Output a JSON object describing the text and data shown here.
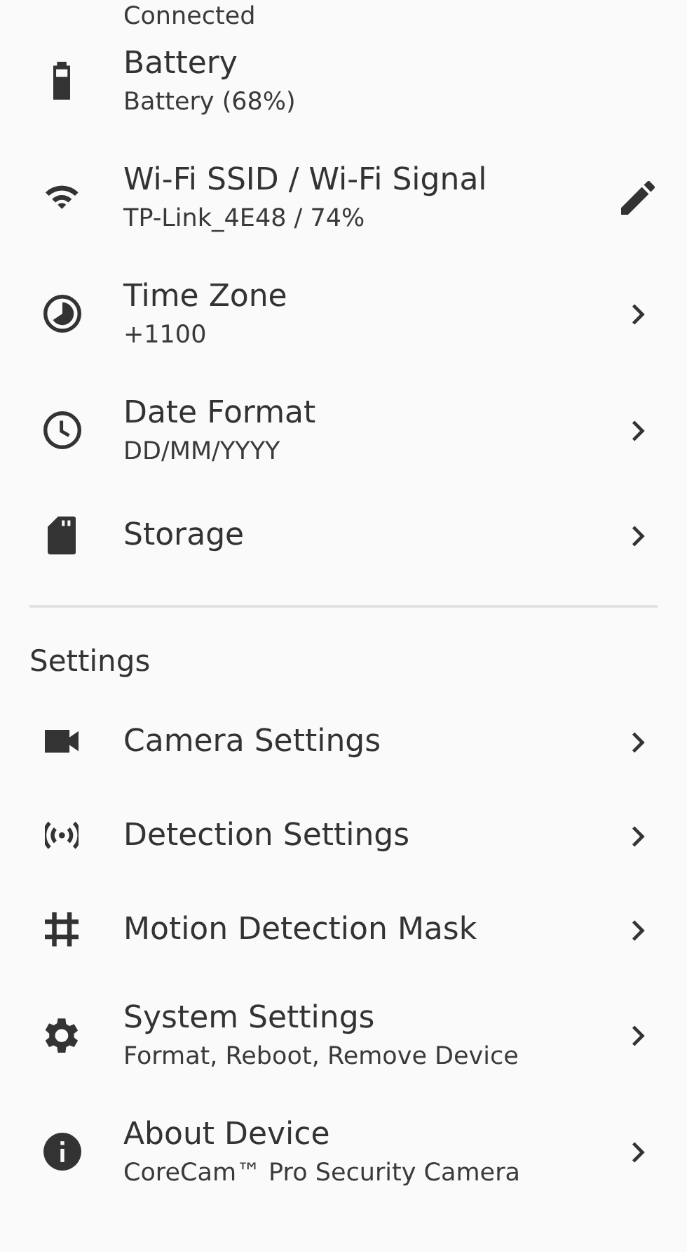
{
  "partial_row": {
    "subtitle": "Connected"
  },
  "device_items": [
    {
      "kind": "battery",
      "title": "Battery",
      "subtitle": "Battery (68%)",
      "editable": false,
      "navigable": false
    },
    {
      "kind": "wifi",
      "title": "Wi-Fi SSID / Wi-Fi Signal",
      "subtitle": "TP-Link_4E48 / 74%",
      "editable": true,
      "navigable": false
    },
    {
      "kind": "timezone",
      "title": "Time Zone",
      "subtitle": "+1100",
      "editable": false,
      "navigable": true
    },
    {
      "kind": "clock",
      "title": "Date Format",
      "subtitle": "DD/MM/YYYY",
      "editable": false,
      "navigable": true
    },
    {
      "kind": "sdcard",
      "title": "Storage",
      "editable": false,
      "navigable": true
    }
  ],
  "settings_section": {
    "header": "Settings",
    "items": [
      {
        "kind": "camera",
        "title": "Camera Settings",
        "editable": false,
        "navigable": true
      },
      {
        "kind": "signal",
        "title": "Detection Settings",
        "editable": false,
        "navigable": true
      },
      {
        "kind": "grid",
        "title": "Motion Detection Mask",
        "editable": false,
        "navigable": true
      },
      {
        "kind": "gear",
        "title": "System Settings",
        "subtitle": "Format, Reboot, Remove Device",
        "editable": false,
        "navigable": true
      },
      {
        "kind": "info",
        "title": "About Device",
        "subtitle": "CoreCam™ Pro Security Camera",
        "editable": false,
        "navigable": true
      }
    ]
  }
}
